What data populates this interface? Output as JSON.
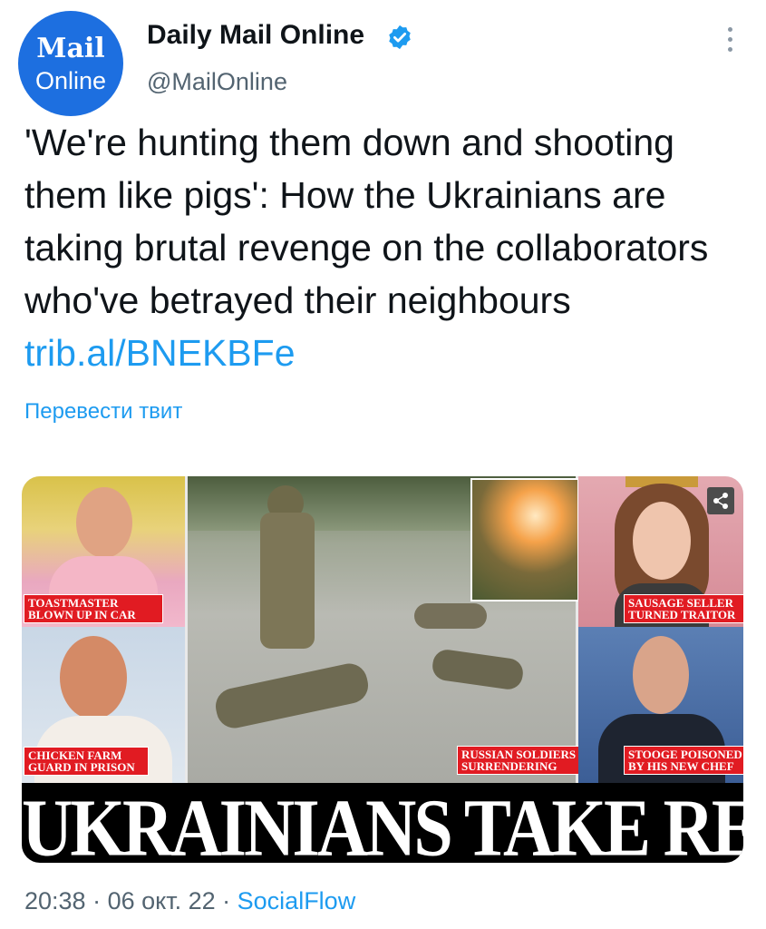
{
  "account": {
    "avatar_line1": "Mail",
    "avatar_line2": "Online",
    "name": "Daily Mail Online",
    "handle": "@MailOnline"
  },
  "tweet": {
    "text": "'We're hunting them down and shooting them like pigs': How the Ukrainians are taking brutal revenge on the collaborators who've betrayed their neighbours",
    "link": "trib.al/BNEKBFe",
    "translate_label": "Перевести твит"
  },
  "media": {
    "captions": {
      "toastmaster": "TOASTMASTER BLOWN UP IN CAR",
      "chicken": "CHICKEN FARM GUARD IN PRISON",
      "russian": "RUSSIAN SOLDIERS SURRENDERING",
      "sausage": "SAUSAGE SELLER TURNED TRAITOR",
      "stooge": "STOOGE POISONED BY HIS NEW CHEF"
    },
    "headline": "UKRAINIANS TAKE REVEGE"
  },
  "meta": {
    "time": "20:38",
    "sep1": " · ",
    "date": "06 окт. 22",
    "sep2": " · ",
    "source": "SocialFlow"
  },
  "colors": {
    "link": "#1d9bf0",
    "verified": "#1d9bf0",
    "caption_red": "#e11b22"
  },
  "icons": [
    "verified-badge-icon",
    "more-options-icon",
    "share-icon"
  ]
}
